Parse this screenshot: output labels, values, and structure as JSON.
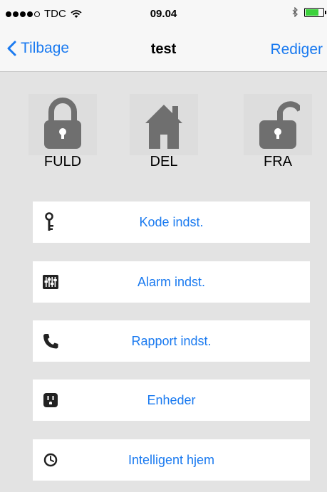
{
  "status_bar": {
    "carrier": "TDC",
    "time": "09.04",
    "signal_bars": 4,
    "signal_max": 5,
    "battery_level": 0.7
  },
  "nav": {
    "back_label": "Tilbage",
    "title": "test",
    "edit_label": "Rediger"
  },
  "modes": [
    {
      "label": "FULD",
      "icon": "lock-closed-icon"
    },
    {
      "label": "DEL",
      "icon": "home-icon"
    },
    {
      "label": "FRA",
      "icon": "lock-open-icon"
    }
  ],
  "menu": [
    {
      "label": "Kode indst.",
      "icon": "key-icon"
    },
    {
      "label": "Alarm indst.",
      "icon": "sliders-icon"
    },
    {
      "label": "Rapport indst.",
      "icon": "phone-icon"
    },
    {
      "label": "Enheder",
      "icon": "outlet-icon"
    },
    {
      "label": "Intelligent hjem",
      "icon": "clock-icon"
    }
  ],
  "colors": {
    "accent": "#1a7af0",
    "icon_gray": "#6f6f6f",
    "background": "#e3e3e3"
  }
}
